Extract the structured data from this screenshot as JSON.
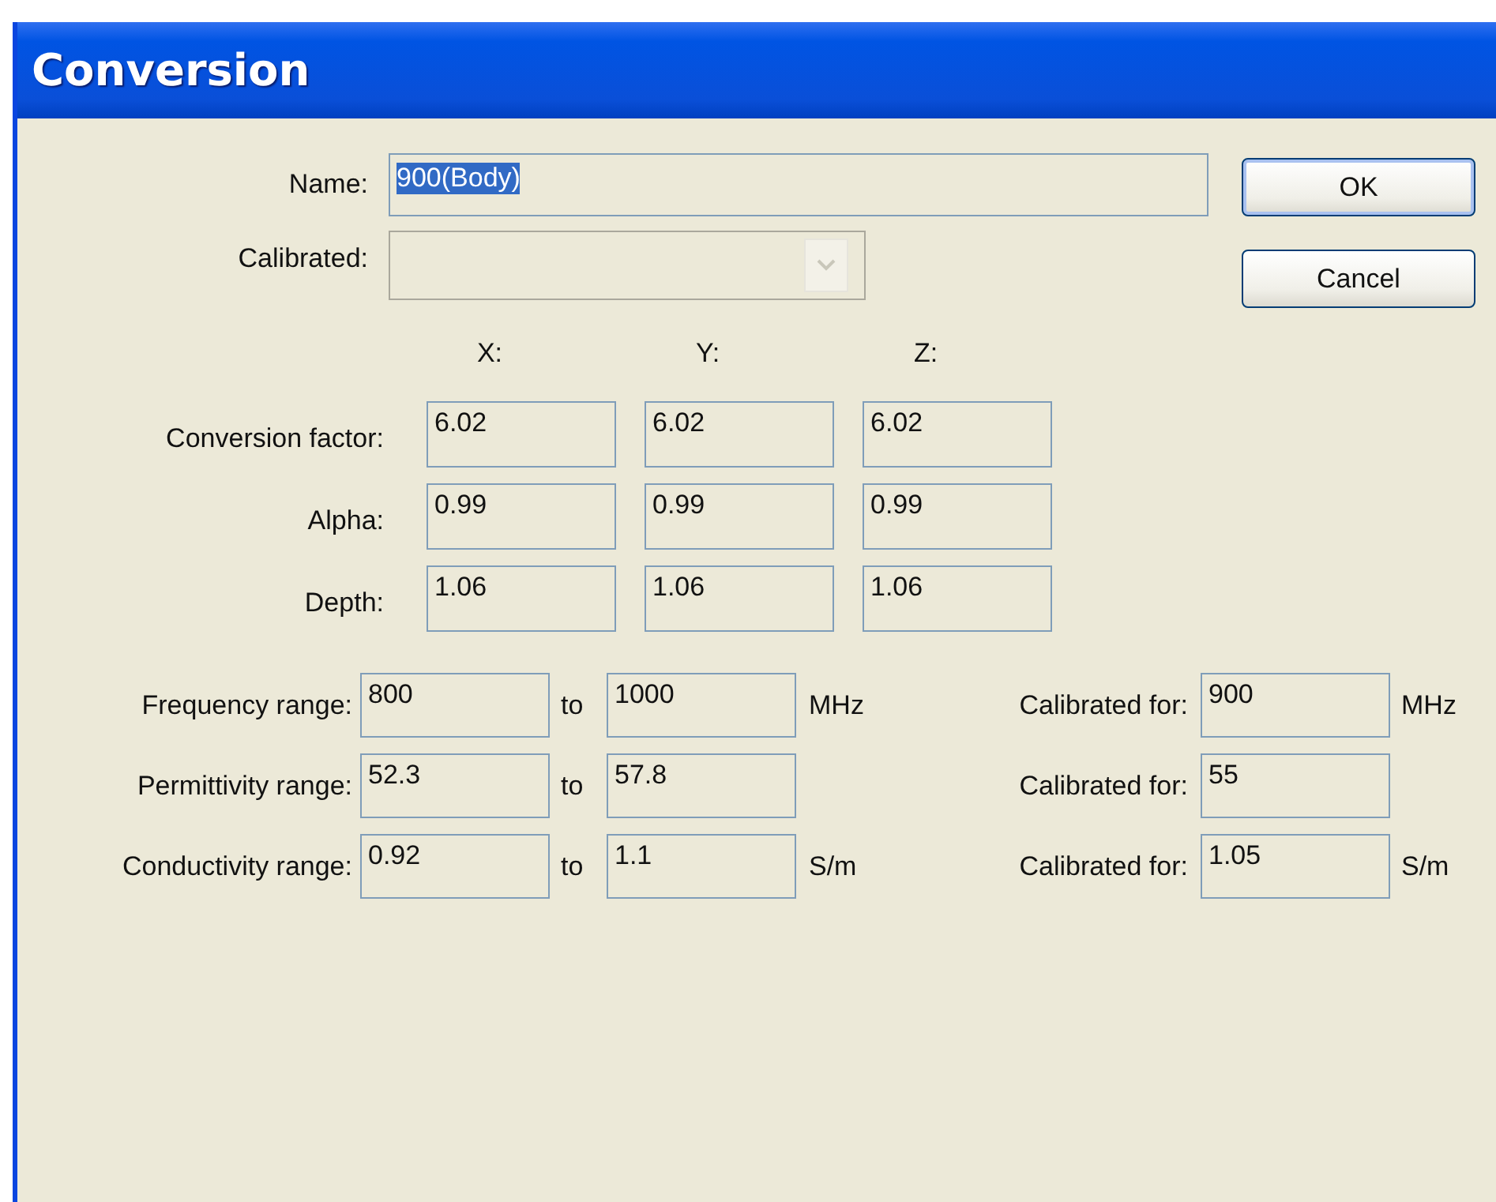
{
  "window": {
    "title": "Conversion"
  },
  "name": {
    "label": "Name:",
    "value": "900(Body)",
    "text_selected": true
  },
  "calibrated": {
    "label": "Calibrated:",
    "disabled": true
  },
  "buttons": [
    {
      "label": "OK",
      "default": true
    },
    {
      "label": "Cancel",
      "default": false
    }
  ],
  "axes": [
    "X:",
    "Y:",
    "Z:"
  ],
  "factors": [
    {
      "label": "Conversion factor:",
      "values": [
        "6.02",
        "6.02",
        "6.02"
      ]
    },
    {
      "label": "Alpha:",
      "values": [
        "0.99",
        "0.99",
        "0.99"
      ]
    },
    {
      "label": "Depth:",
      "values": [
        "1.06",
        "1.06",
        "1.06"
      ]
    }
  ],
  "ranges": [
    {
      "label": "Frequency range:",
      "from": "800",
      "to_label": "to",
      "to": "1000",
      "unit": "MHz",
      "calibrated_label": "Calibrated for:",
      "calibrated_value": "900",
      "calibrated_unit": "MHz"
    },
    {
      "label": "Permittivity range:",
      "from": "52.3",
      "to_label": "to",
      "to": "57.8",
      "calibrated_label": "Calibrated for:",
      "calibrated_value": "55"
    },
    {
      "label": "Conductivity range:",
      "from": "0.92",
      "to_label": "to",
      "to": "1.1",
      "unit": "S/m",
      "calibrated_label": "Calibrated for:",
      "calibrated_value": "1.05",
      "calibrated_unit": "S/m"
    }
  ]
}
